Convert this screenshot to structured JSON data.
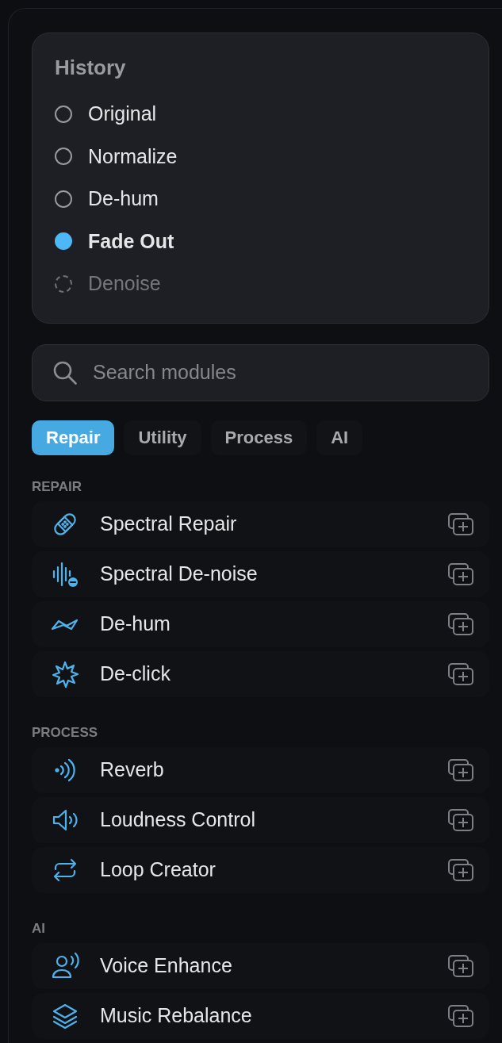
{
  "history": {
    "title": "History",
    "items": [
      {
        "label": "Original",
        "selected": false,
        "disabled": false
      },
      {
        "label": "Normalize",
        "selected": false,
        "disabled": false
      },
      {
        "label": "De-hum",
        "selected": false,
        "disabled": false
      },
      {
        "label": "Fade Out",
        "selected": true,
        "disabled": false
      },
      {
        "label": "Denoise",
        "selected": false,
        "disabled": true
      }
    ]
  },
  "search": {
    "placeholder": "Search modules"
  },
  "tabs": [
    {
      "label": "Repair",
      "selected": true
    },
    {
      "label": "Utility",
      "selected": false
    },
    {
      "label": "Process",
      "selected": false
    },
    {
      "label": "AI",
      "selected": false
    }
  ],
  "sections": [
    {
      "title": "REPAIR",
      "modules": [
        {
          "name": "Spectral Repair"
        },
        {
          "name": "Spectral De-noise"
        },
        {
          "name": "De-hum"
        },
        {
          "name": "De-click"
        }
      ]
    },
    {
      "title": "PROCESS",
      "modules": [
        {
          "name": "Reverb"
        },
        {
          "name": "Loudness Control"
        },
        {
          "name": "Loop Creator"
        }
      ]
    },
    {
      "title": "AI",
      "modules": [
        {
          "name": "Voice Enhance"
        },
        {
          "name": "Music Rebalance"
        }
      ]
    }
  ]
}
